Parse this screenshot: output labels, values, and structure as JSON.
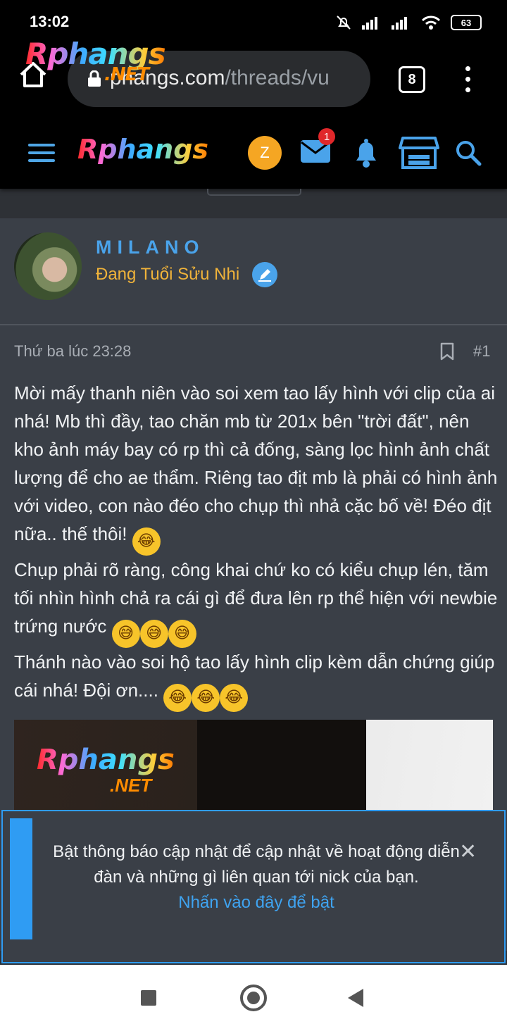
{
  "status_bar": {
    "time": "13:02",
    "battery": "63"
  },
  "browser": {
    "url_main": "phangs.com",
    "url_path": "/threads/vu",
    "tab_count": "8",
    "logo_overlay": "Rphangs",
    "logo_overlay_net": ".NET"
  },
  "header": {
    "brand": "Rphangs",
    "avatar_letter": "Z",
    "mail_badge": "1"
  },
  "post": {
    "username": "MILANO",
    "user_title": "Đang Tuổi Sửu Nhi",
    "date": "Thứ ba lúc 23:28",
    "number": "#1",
    "lines": [
      "Mời mấy thanh niên vào soi xem tao lấy hình với clip của ai nhá! Mb thì đầy, tao chăn mb từ 201x bên \"trời đất\", nên kho ảnh máy bay có rp thì cả đống, sàng lọc hình ảnh chất lượng để cho ae thẩm. Riêng tao địt mb là phải có hình ảnh với video, con nào đéo cho chụp thì nhả cặc bố về! Đéo địt nữa.. thế thôi!",
      "Chụp phải rõ ràng, công khai chứ ko có kiểu chụp lén, tăm tối nhìn hình chả ra cái gì để đưa lên rp thể hiện với newbie trứng nước",
      "Thánh nào vào soi hộ tao lấy hình clip kèm dẫn chứng giúp cái nhá! Đội ơn...."
    ],
    "image_logo": "Rphangs",
    "image_logo_net": ".NET"
  },
  "notification": {
    "text": "Bật thông báo cập nhật để cập nhật về hoạt động diễn đàn và những gì liên quan tới nick của bạn.",
    "link": "Nhấn vào đây để bật",
    "close": "✕"
  },
  "colors": {
    "accent": "#4aa3ea",
    "title": "#f0b33a",
    "badge": "#e0272a",
    "notice_border": "#2f9cf3"
  },
  "icons": [
    "home-icon",
    "lock-icon",
    "menu-icon",
    "mail-icon",
    "bell-icon",
    "store-icon",
    "search-icon",
    "bookmark-icon",
    "edit-badge-icon",
    "laugh-emoji",
    "grin-sweat-emoji"
  ]
}
